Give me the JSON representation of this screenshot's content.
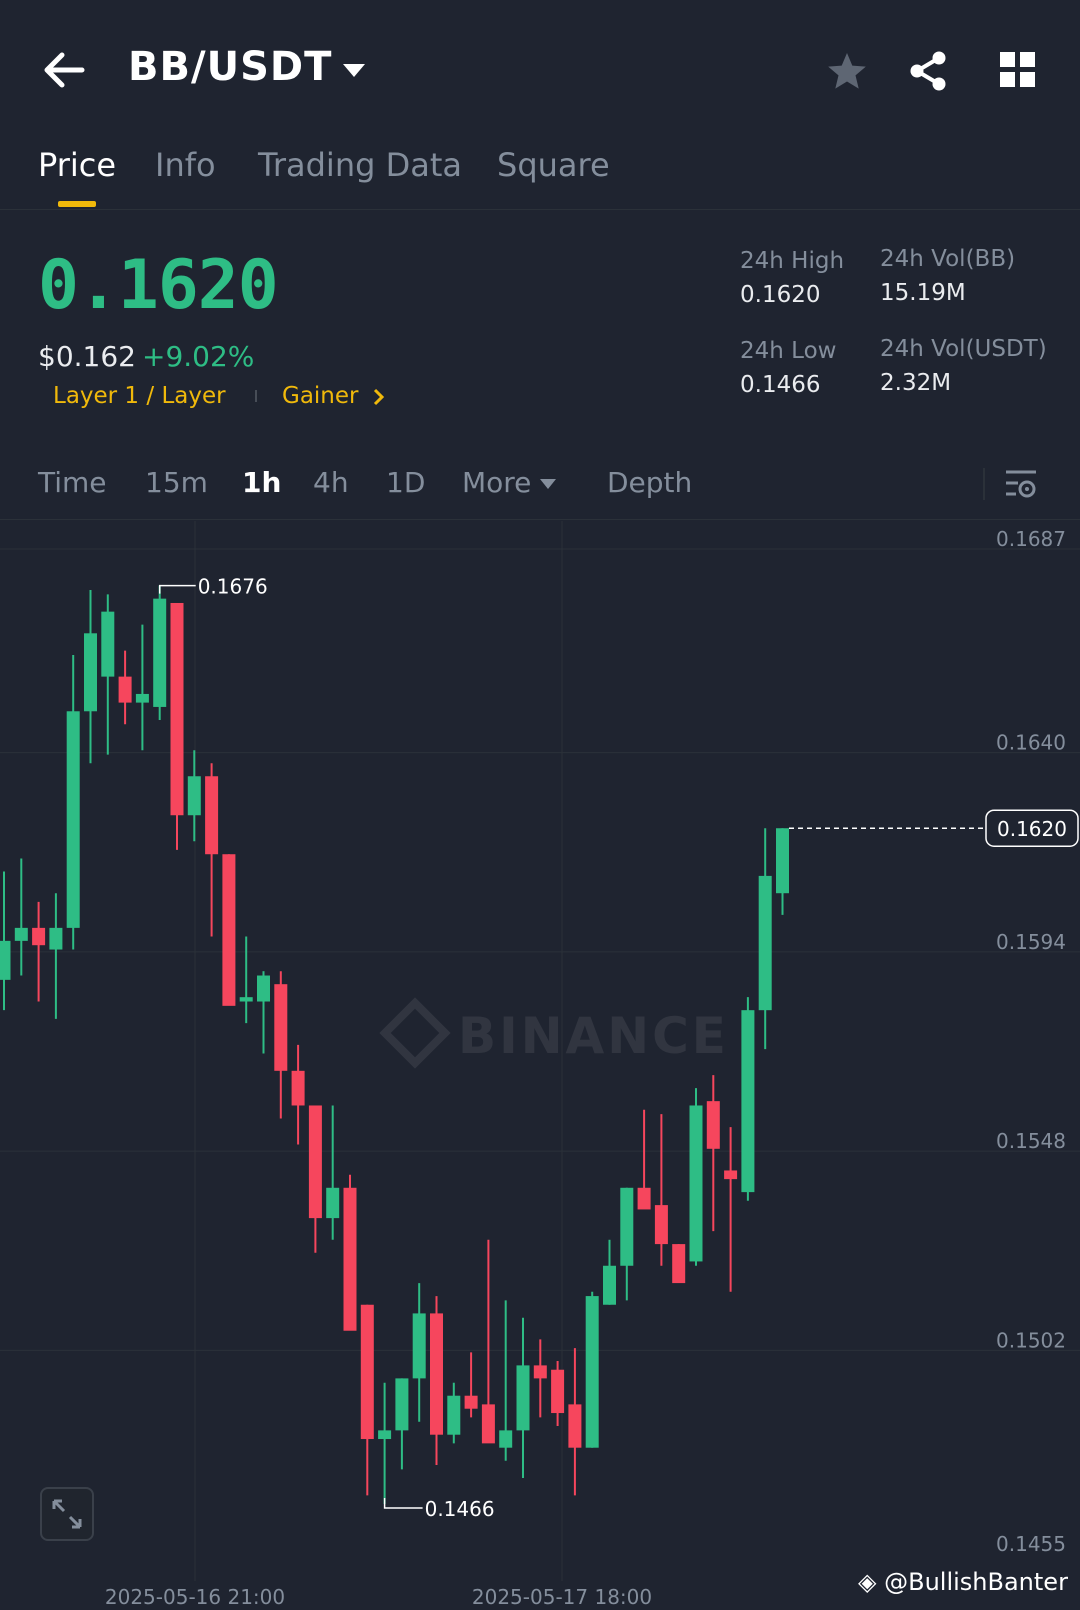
{
  "header": {
    "pair": "BB/USDT",
    "icons": [
      "back-arrow-icon",
      "caret-down-icon",
      "star-icon",
      "share-icon",
      "grid-icon"
    ]
  },
  "tabs": [
    {
      "label": "Price",
      "active": true
    },
    {
      "label": "Info",
      "active": false
    },
    {
      "label": "Trading Data",
      "active": false
    },
    {
      "label": "Square",
      "active": false
    }
  ],
  "ticker": {
    "price": "0.1620",
    "usd_price": "$0.162",
    "change": "+9.02%",
    "tag_category": "Layer 1 / Layer",
    "tag_gainer": "Gainer",
    "high_label": "24h High",
    "high_value": "0.1620",
    "low_label": "24h Low",
    "low_value": "0.1466",
    "vol_base_label": "24h Vol(BB)",
    "vol_base_value": "15.19M",
    "vol_quote_label": "24h Vol(USDT)",
    "vol_quote_value": "2.32M"
  },
  "toolbar": {
    "time": "Time",
    "tf_15m": "15m",
    "tf_1h": "1h",
    "tf_4h": "4h",
    "tf_1d": "1D",
    "more": "More",
    "depth": "Depth",
    "active": "1h"
  },
  "colors": {
    "up": "#2ebd85",
    "down": "#f6465d",
    "accent": "#f0b90b",
    "background": "#1f2430"
  },
  "chart_data": {
    "type": "candlestick",
    "y_ticks": [
      "0.1687",
      "0.1640",
      "0.1594",
      "0.1548",
      "0.1502",
      "0.1455"
    ],
    "ylim": [
      0.1455,
      0.1687
    ],
    "x_ticks": [
      "2025-05-16 21:00",
      "2025-05-17 18:00"
    ],
    "high_marker": "0.1676",
    "low_marker": "0.1466",
    "last_price": "0.1620",
    "watermark": "BINANCE",
    "credit": "@BullishBanter",
    "candles": [
      {
        "o": 0.1585,
        "h": 0.161,
        "l": 0.1578,
        "c": 0.1594
      },
      {
        "o": 0.1594,
        "h": 0.1613,
        "l": 0.1586,
        "c": 0.1597
      },
      {
        "o": 0.1597,
        "h": 0.1603,
        "l": 0.158,
        "c": 0.1593
      },
      {
        "o": 0.1592,
        "h": 0.1605,
        "l": 0.1576,
        "c": 0.1597
      },
      {
        "o": 0.1597,
        "h": 0.166,
        "l": 0.1592,
        "c": 0.1647
      },
      {
        "o": 0.1647,
        "h": 0.1675,
        "l": 0.1635,
        "c": 0.1665
      },
      {
        "o": 0.1655,
        "h": 0.1674,
        "l": 0.1637,
        "c": 0.167
      },
      {
        "o": 0.1655,
        "h": 0.1661,
        "l": 0.1644,
        "c": 0.1649
      },
      {
        "o": 0.1649,
        "h": 0.1667,
        "l": 0.1638,
        "c": 0.1651
      },
      {
        "o": 0.1648,
        "h": 0.1676,
        "l": 0.1645,
        "c": 0.1673
      },
      {
        "o": 0.1672,
        "h": 0.1672,
        "l": 0.1615,
        "c": 0.1623
      },
      {
        "o": 0.1623,
        "h": 0.1638,
        "l": 0.1617,
        "c": 0.1632
      },
      {
        "o": 0.1632,
        "h": 0.1635,
        "l": 0.1595,
        "c": 0.1614
      },
      {
        "o": 0.1614,
        "h": 0.1614,
        "l": 0.1583,
        "c": 0.1579
      },
      {
        "o": 0.158,
        "h": 0.1595,
        "l": 0.1575,
        "c": 0.1581
      },
      {
        "o": 0.158,
        "h": 0.1587,
        "l": 0.1568,
        "c": 0.1586
      },
      {
        "o": 0.1584,
        "h": 0.1587,
        "l": 0.1553,
        "c": 0.1564
      },
      {
        "o": 0.1564,
        "h": 0.157,
        "l": 0.1547,
        "c": 0.1556
      },
      {
        "o": 0.1556,
        "h": 0.1556,
        "l": 0.1522,
        "c": 0.153
      },
      {
        "o": 0.153,
        "h": 0.1556,
        "l": 0.1525,
        "c": 0.1537
      },
      {
        "o": 0.1537,
        "h": 0.154,
        "l": 0.1505,
        "c": 0.1504
      },
      {
        "o": 0.151,
        "h": 0.151,
        "l": 0.1466,
        "c": 0.1479
      },
      {
        "o": 0.1479,
        "h": 0.1492,
        "l": 0.1464,
        "c": 0.1481
      },
      {
        "o": 0.1481,
        "h": 0.1493,
        "l": 0.1472,
        "c": 0.1493
      },
      {
        "o": 0.1493,
        "h": 0.1515,
        "l": 0.1483,
        "c": 0.1508
      },
      {
        "o": 0.1508,
        "h": 0.1512,
        "l": 0.1473,
        "c": 0.148
      },
      {
        "o": 0.148,
        "h": 0.1492,
        "l": 0.1478,
        "c": 0.1489
      },
      {
        "o": 0.1489,
        "h": 0.1499,
        "l": 0.1484,
        "c": 0.1486
      },
      {
        "o": 0.1487,
        "h": 0.1525,
        "l": 0.148,
        "c": 0.1478
      },
      {
        "o": 0.1477,
        "h": 0.1511,
        "l": 0.1474,
        "c": 0.1481
      },
      {
        "o": 0.1481,
        "h": 0.1507,
        "l": 0.147,
        "c": 0.1496
      },
      {
        "o": 0.1496,
        "h": 0.1502,
        "l": 0.1484,
        "c": 0.1493
      },
      {
        "o": 0.1495,
        "h": 0.1497,
        "l": 0.1482,
        "c": 0.1485
      },
      {
        "o": 0.1487,
        "h": 0.15,
        "l": 0.1466,
        "c": 0.1477
      },
      {
        "o": 0.1477,
        "h": 0.1513,
        "l": 0.1477,
        "c": 0.1512
      },
      {
        "o": 0.151,
        "h": 0.1525,
        "l": 0.151,
        "c": 0.1519
      },
      {
        "o": 0.1519,
        "h": 0.1537,
        "l": 0.1511,
        "c": 0.1537
      },
      {
        "o": 0.1537,
        "h": 0.1555,
        "l": 0.1535,
        "c": 0.1532
      },
      {
        "o": 0.1533,
        "h": 0.1554,
        "l": 0.1519,
        "c": 0.1524
      },
      {
        "o": 0.1524,
        "h": 0.1524,
        "l": 0.1516,
        "c": 0.1515
      },
      {
        "o": 0.152,
        "h": 0.156,
        "l": 0.1519,
        "c": 0.1556
      },
      {
        "o": 0.1557,
        "h": 0.1563,
        "l": 0.1527,
        "c": 0.1546
      },
      {
        "o": 0.1541,
        "h": 0.1551,
        "l": 0.1513,
        "c": 0.1539
      },
      {
        "o": 0.1536,
        "h": 0.1581,
        "l": 0.1534,
        "c": 0.1578
      },
      {
        "o": 0.1578,
        "h": 0.162,
        "l": 0.1569,
        "c": 0.1609
      },
      {
        "o": 0.1605,
        "h": 0.162,
        "l": 0.16,
        "c": 0.162
      }
    ]
  }
}
